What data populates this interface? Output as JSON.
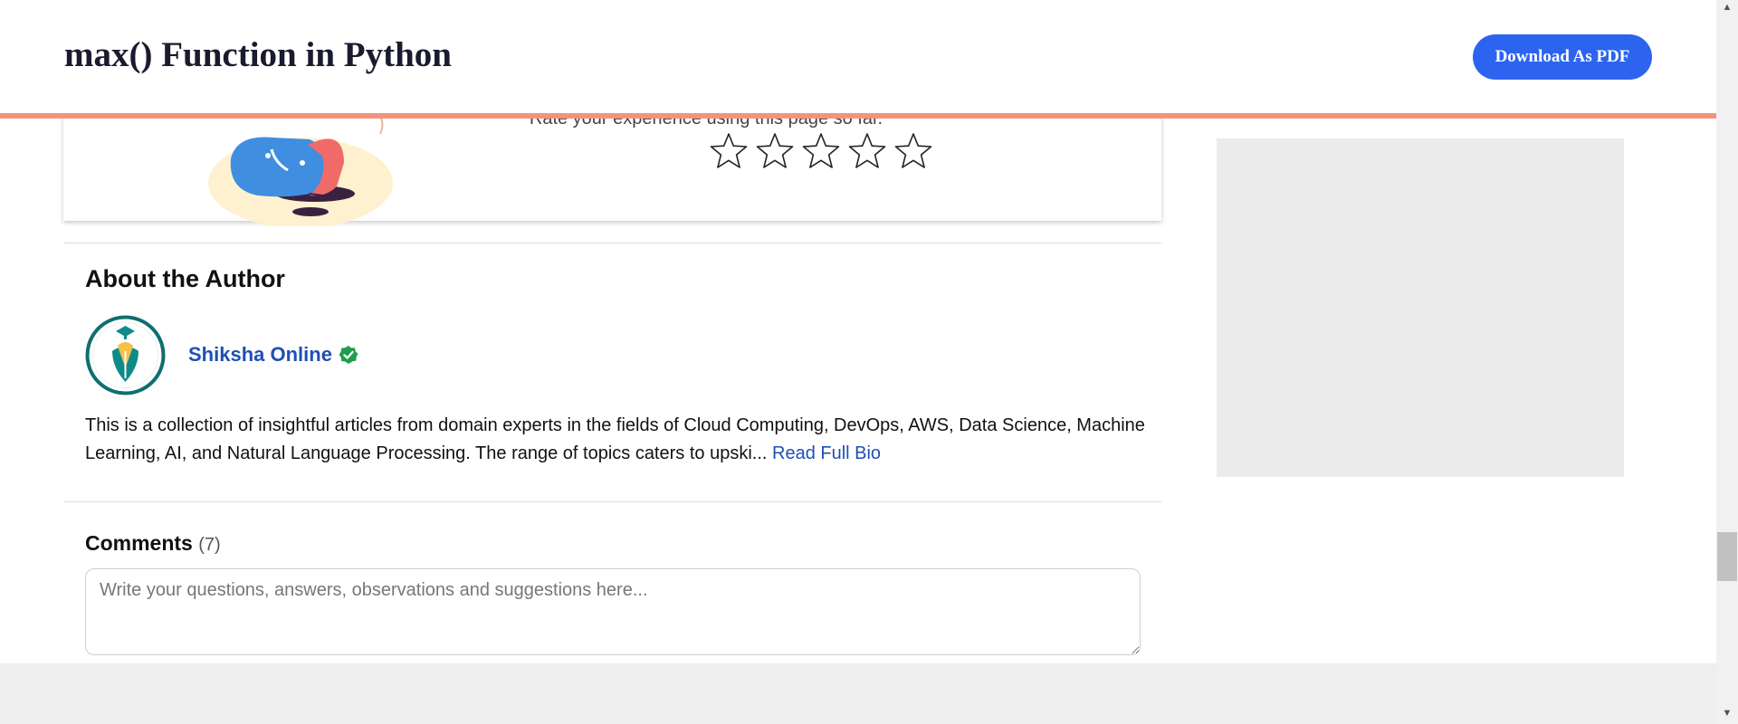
{
  "header": {
    "title": "max() Function in Python",
    "download_label": "Download As PDF"
  },
  "rating": {
    "prompt": "Rate your experience using this page so far.",
    "stars_total": 5,
    "stars_selected": 0
  },
  "author": {
    "heading": "About the Author",
    "name": "Shiksha Online",
    "bio": "This is a collection of insightful articles from domain experts in the fields of Cloud Computing, DevOps, AWS, Data Science, Machine Learning, AI, and Natural Language Processing. The range of topics caters to upski...",
    "read_more": "Read Full Bio"
  },
  "comments": {
    "heading": "Comments",
    "count": "(7)",
    "placeholder": "Write your questions, answers, observations and suggestions here..."
  },
  "colors": {
    "accent": "#2c64f0",
    "progress": "#f4937c",
    "link": "#1f4fb5",
    "verified": "#1e9e4a",
    "avatar_ring": "#0f6f6f"
  },
  "icons": {
    "star": "star-outline-icon",
    "verified": "verified-check-icon"
  }
}
